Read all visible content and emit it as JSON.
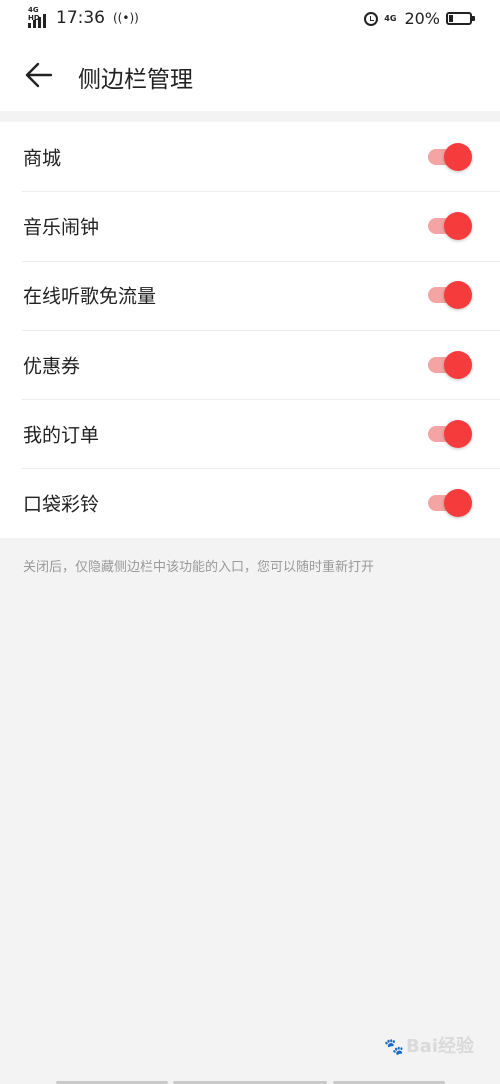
{
  "status_bar": {
    "network_tag": "4G HD",
    "time": "17:36",
    "mobile_data": "4G",
    "battery_percent": "20%",
    "battery_level": 0.2
  },
  "header": {
    "title": "侧边栏管理"
  },
  "settings": [
    {
      "label": "商城",
      "enabled": true
    },
    {
      "label": "音乐闹钟",
      "enabled": true
    },
    {
      "label": "在线听歌免流量",
      "enabled": true
    },
    {
      "label": "优惠券",
      "enabled": true
    },
    {
      "label": "我的订单",
      "enabled": true
    },
    {
      "label": "口袋彩铃",
      "enabled": true
    }
  ],
  "footer_note": "关闭后，仅隐藏侧边栏中该功能的入口，您可以随时重新打开",
  "watermark": "Bai经验",
  "colors": {
    "accent": "#f53b3b",
    "track": "#f5a4a4",
    "background": "#f3f3f3"
  }
}
